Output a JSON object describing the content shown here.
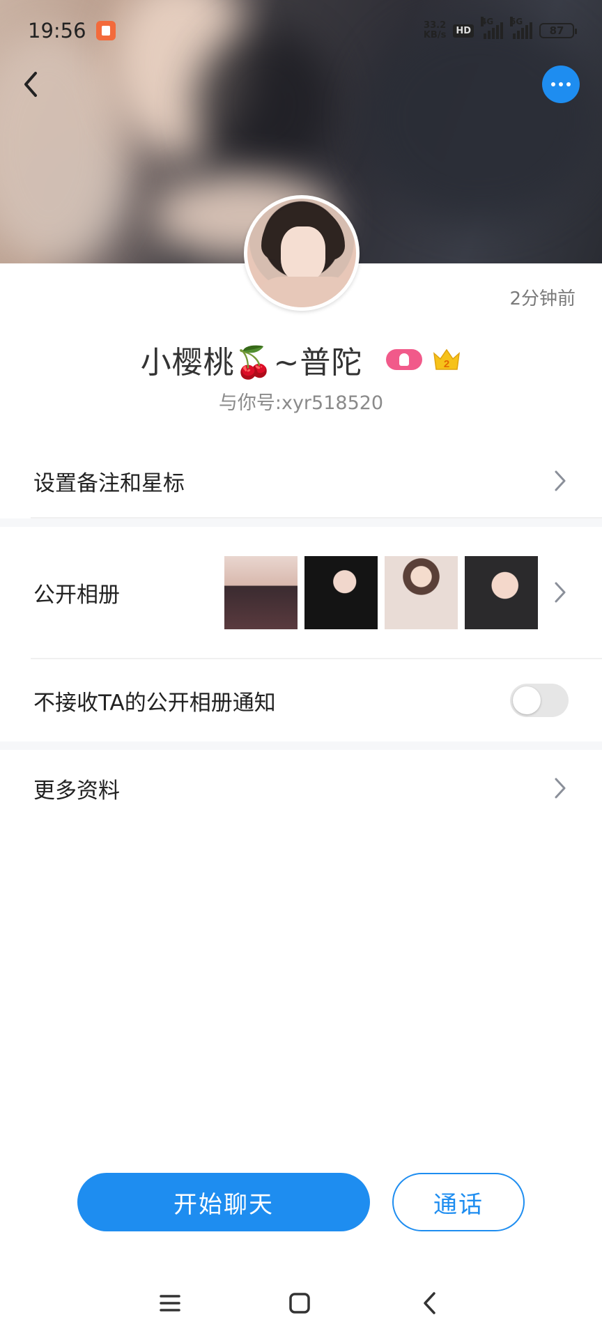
{
  "status_bar": {
    "time": "19:56",
    "net_speed_value": "33.2",
    "net_speed_unit": "KB/s",
    "hd": "HD",
    "signal1": "4G",
    "signal2": "5G",
    "battery": "87"
  },
  "profile": {
    "last_seen": "2分钟前",
    "name": "小樱桃🍒~普陀",
    "user_id": "与你号:xyr518520",
    "crown_level": "2"
  },
  "rows": {
    "remark": "设置备注和星标",
    "album": "公开相册",
    "notify": "不接收TA的公开相册通知",
    "more_info": "更多资料"
  },
  "notify_toggle_on": false,
  "actions": {
    "chat": "开始聊天",
    "call": "通话"
  },
  "colors": {
    "accent": "#1e8df0",
    "badge_pink": "#f15a8a",
    "crown": "#f6c21a"
  }
}
